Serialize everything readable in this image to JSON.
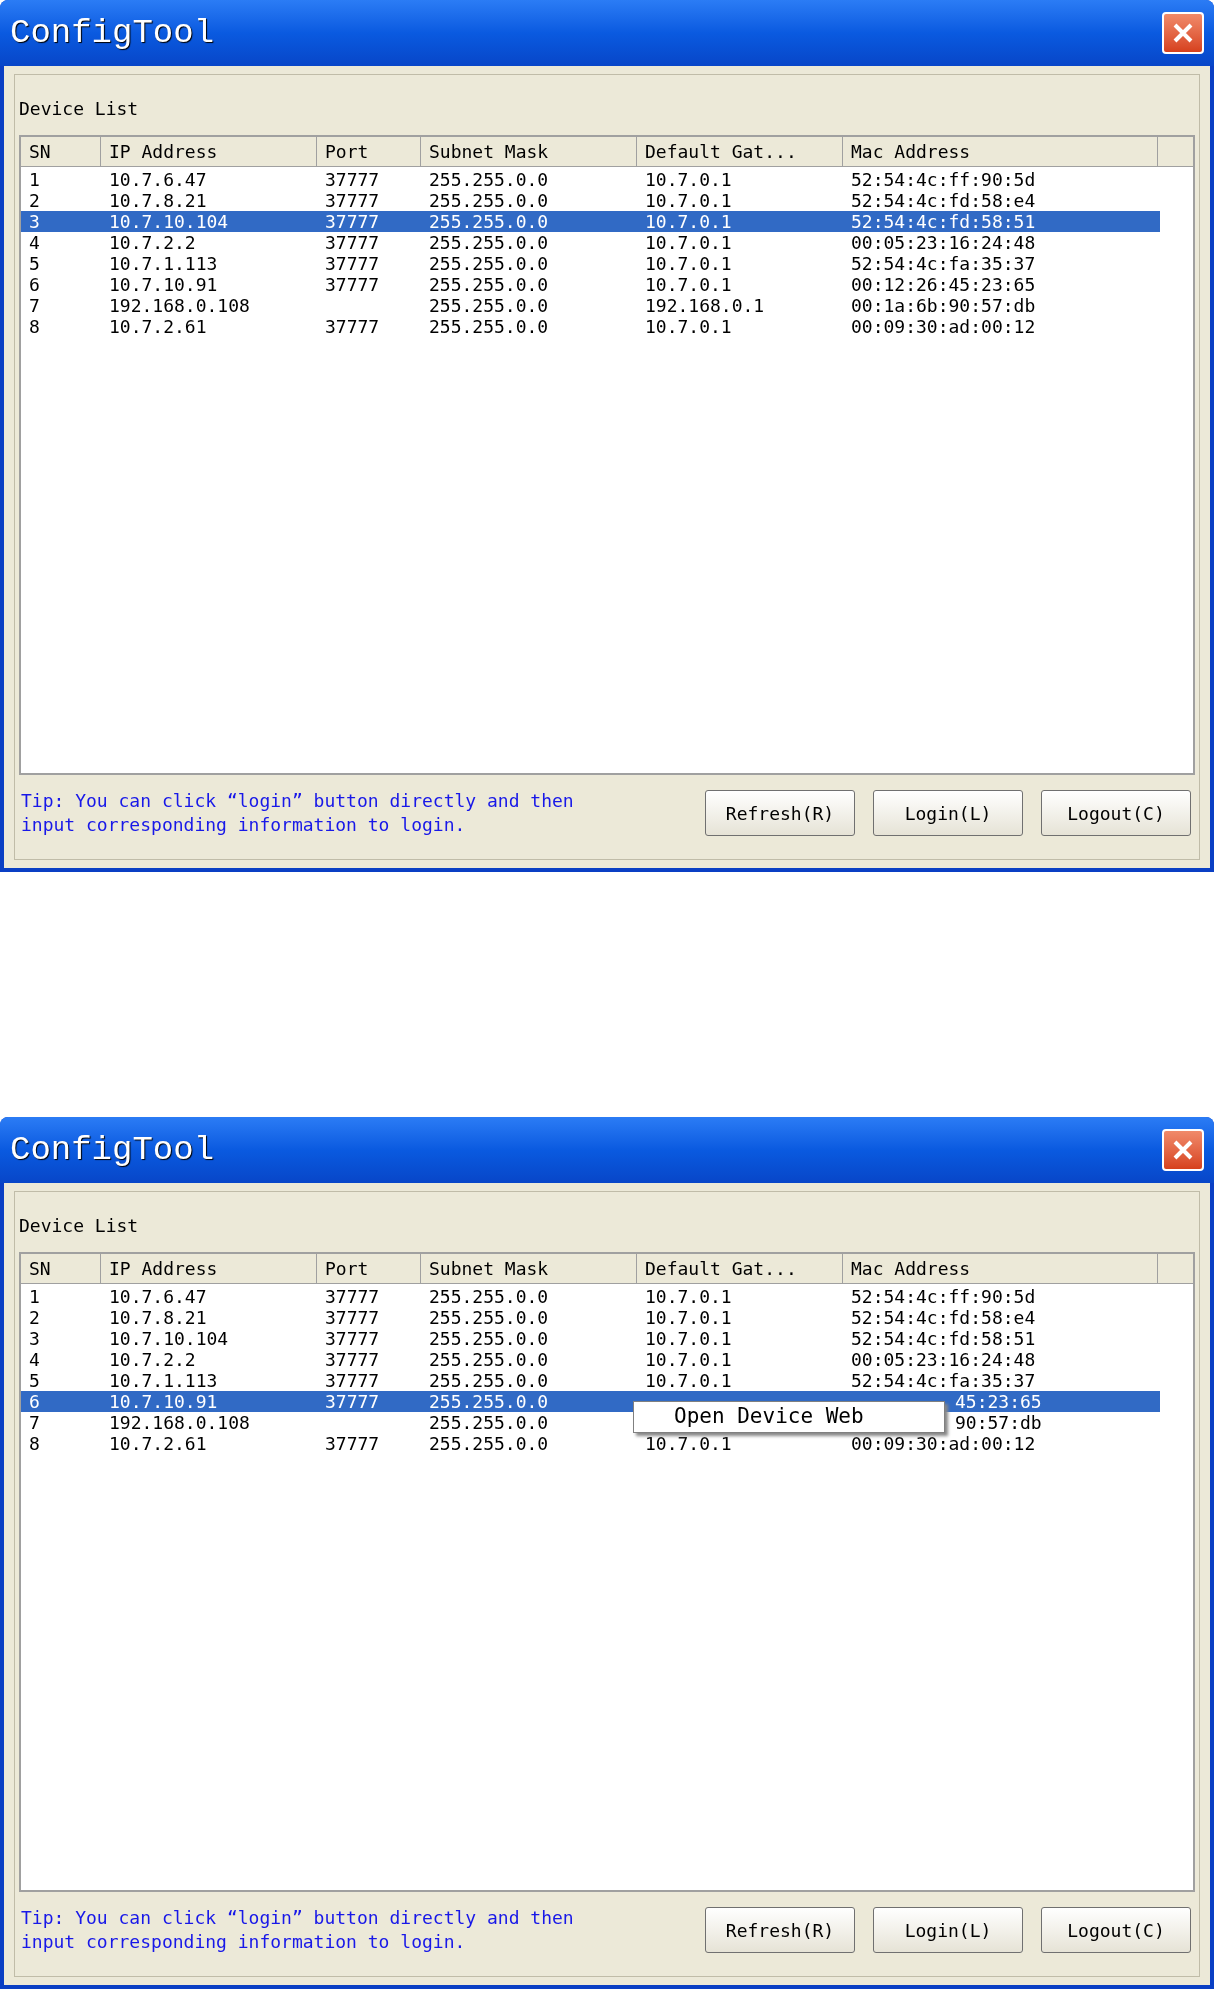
{
  "windows": [
    {
      "title": "ConfigTool",
      "group_label": "Device List",
      "columns": [
        "SN",
        "IP Address",
        "Port",
        "Subnet Mask",
        "Default Gat...",
        "Mac Address"
      ],
      "rows": [
        {
          "selected": false,
          "cells": [
            "1",
            "10.7.6.47",
            "37777",
            "255.255.0.0",
            "10.7.0.1",
            "52:54:4c:ff:90:5d"
          ]
        },
        {
          "selected": false,
          "cells": [
            "2",
            "10.7.8.21",
            "37777",
            "255.255.0.0",
            "10.7.0.1",
            "52:54:4c:fd:58:e4"
          ]
        },
        {
          "selected": true,
          "cells": [
            "3",
            "10.7.10.104",
            "37777",
            "255.255.0.0",
            "10.7.0.1",
            "52:54:4c:fd:58:51"
          ]
        },
        {
          "selected": false,
          "cells": [
            "4",
            "10.7.2.2",
            "37777",
            "255.255.0.0",
            "10.7.0.1",
            "00:05:23:16:24:48"
          ]
        },
        {
          "selected": false,
          "cells": [
            "5",
            "10.7.1.113",
            "37777",
            "255.255.0.0",
            "10.7.0.1",
            "52:54:4c:fa:35:37"
          ]
        },
        {
          "selected": false,
          "cells": [
            "6",
            "10.7.10.91",
            "37777",
            "255.255.0.0",
            "10.7.0.1",
            "00:12:26:45:23:65"
          ]
        },
        {
          "selected": false,
          "cells": [
            "7",
            "192.168.0.108",
            {
              "kind": "empty"
            },
            "255.255.0.0",
            "192.168.0.1",
            "00:1a:6b:90:57:db"
          ]
        },
        {
          "selected": false,
          "cells": [
            "8",
            "10.7.2.61",
            "37777",
            "255.255.0.0",
            "10.7.0.1",
            "00:09:30:ad:00:12"
          ]
        }
      ],
      "tip": "Tip: You can click “login” button directly and then input corresponding information to login.",
      "buttons": [
        "Refresh(R)",
        "Login(L)",
        "Logout(C)"
      ]
    },
    {
      "title": "ConfigTool",
      "group_label": "Device List",
      "columns": [
        "SN",
        "IP Address",
        "Port",
        "Subnet Mask",
        "Default Gat...",
        "Mac Address"
      ],
      "rows": [
        {
          "selected": false,
          "cells": [
            "1",
            "10.7.6.47",
            "37777",
            "255.255.0.0",
            "10.7.0.1",
            "52:54:4c:ff:90:5d"
          ]
        },
        {
          "selected": false,
          "cells": [
            "2",
            "10.7.8.21",
            "37777",
            "255.255.0.0",
            "10.7.0.1",
            "52:54:4c:fd:58:e4"
          ]
        },
        {
          "selected": false,
          "cells": [
            "3",
            "10.7.10.104",
            "37777",
            "255.255.0.0",
            "10.7.0.1",
            "52:54:4c:fd:58:51"
          ]
        },
        {
          "selected": false,
          "cells": [
            "4",
            "10.7.2.2",
            "37777",
            "255.255.0.0",
            "10.7.0.1",
            "00:05:23:16:24:48"
          ]
        },
        {
          "selected": false,
          "cells": [
            "5",
            "10.7.1.113",
            "37777",
            "255.255.0.0",
            "10.7.0.1",
            "52:54:4c:fa:35:37"
          ]
        },
        {
          "selected": true,
          "cells": [
            "6",
            "10.7.10.91",
            "37777",
            "255.255.0.0",
            {
              "kind": "covered"
            },
            {
              "kind": "cut",
              "text": "45:23:65"
            }
          ]
        },
        {
          "selected": false,
          "cells": [
            "7",
            "192.168.0.108",
            {
              "kind": "empty"
            },
            "255.255.0.0",
            {
              "kind": "covered"
            },
            {
              "kind": "cut",
              "text": "90:57:db"
            }
          ]
        },
        {
          "selected": false,
          "cells": [
            "8",
            "10.7.2.61",
            "37777",
            "255.255.0.0",
            "10.7.0.1",
            "00:09:30:ad:00:12"
          ]
        }
      ],
      "context_menu": {
        "items": [
          {
            "label": "Open Device Web"
          }
        ]
      },
      "tip": "Tip: You can click “login” button directly and then input corresponding information to login.",
      "buttons": [
        "Refresh(R)",
        "Login(L)",
        "Logout(C)"
      ]
    }
  ]
}
